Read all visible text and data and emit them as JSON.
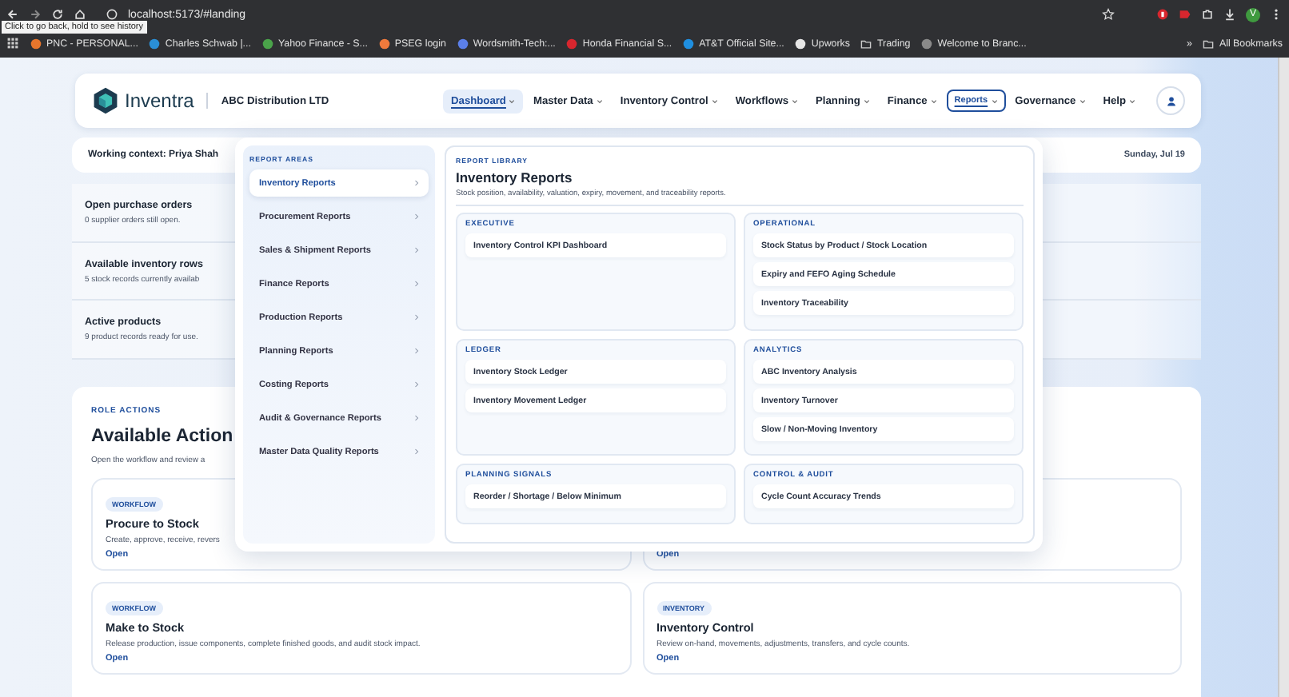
{
  "browser": {
    "url": "localhost:5173/#landing",
    "tooltip": "Click to go back, hold to see history",
    "profile_initial": "V",
    "bookmarks": [
      {
        "label": "PNC - PERSONAL...",
        "kind": "site",
        "color": "#e8762c"
      },
      {
        "label": "Charles Schwab |...",
        "kind": "site",
        "color": "#2a8fd6"
      },
      {
        "label": "Yahoo Finance - S...",
        "kind": "site",
        "color": "#4aa34a"
      },
      {
        "label": "PSEG login",
        "kind": "site",
        "color": "#f07a3c"
      },
      {
        "label": "Wordsmith-Tech:...",
        "kind": "site",
        "color": "#5b7fe8"
      },
      {
        "label": "Honda Financial S...",
        "kind": "site",
        "color": "#d8262e"
      },
      {
        "label": "AT&T Official Site...",
        "kind": "site",
        "color": "#1f8fe0"
      },
      {
        "label": "Upworks",
        "kind": "site",
        "color": "#e6e6e6"
      },
      {
        "label": "Trading",
        "kind": "folder"
      },
      {
        "label": "Welcome to Branc...",
        "kind": "site",
        "color": "#8a8a8a"
      }
    ],
    "overflow": "»",
    "all_bookmarks": "All Bookmarks"
  },
  "header": {
    "brand": "Inventra",
    "company": "ABC Distribution LTD",
    "nav": [
      {
        "label": "Dashboard",
        "selected": true,
        "open": false
      },
      {
        "label": "Master Data",
        "selected": false,
        "open": false
      },
      {
        "label": "Inventory Control",
        "selected": false,
        "open": false
      },
      {
        "label": "Workflows",
        "selected": false,
        "open": false
      },
      {
        "label": "Planning",
        "selected": false,
        "open": false
      },
      {
        "label": "Finance",
        "selected": false,
        "open": false
      },
      {
        "label": "Reports",
        "selected": false,
        "open": true
      },
      {
        "label": "Governance",
        "selected": false,
        "open": false
      },
      {
        "label": "Help",
        "selected": false,
        "open": false
      }
    ]
  },
  "context": {
    "text": "Working context: Priya Shah",
    "date": "Sunday, Jul 19"
  },
  "stats": [
    {
      "title": "Open purchase orders",
      "detail": "0 supplier orders still open."
    },
    {
      "title": "Available inventory rows",
      "detail": "5 stock records currently availab"
    },
    {
      "title": "Active products",
      "detail": "9 product records ready for use."
    }
  ],
  "role_actions": {
    "eyebrow": "ROLE ACTIONS",
    "title": "Available Action",
    "subtitle": "Open the workflow and review a",
    "cards": [
      {
        "badge": "WORKFLOW",
        "title": "Procure to Stock",
        "description": "Create, approve, receive, revers",
        "link": "Open"
      },
      {
        "link": "Open"
      },
      {
        "badge": "WORKFLOW",
        "title": "Make to Stock",
        "description": "Release production, issue components, complete finished goods, and audit stock impact.",
        "link": "Open"
      },
      {
        "badge": "INVENTORY",
        "title": "Inventory Control",
        "description": "Review on-hand, movements, adjustments, transfers, and cycle counts.",
        "link": "Open"
      }
    ]
  },
  "reports_menu": {
    "areas_heading": "REPORT AREAS",
    "areas": [
      {
        "label": "Inventory Reports",
        "selected": true
      },
      {
        "label": "Procurement Reports",
        "selected": false
      },
      {
        "label": "Sales & Shipment Reports",
        "selected": false
      },
      {
        "label": "Finance Reports",
        "selected": false
      },
      {
        "label": "Production Reports",
        "selected": false
      },
      {
        "label": "Planning Reports",
        "selected": false
      },
      {
        "label": "Costing Reports",
        "selected": false
      },
      {
        "label": "Audit & Governance Reports",
        "selected": false
      },
      {
        "label": "Master Data Quality Reports",
        "selected": false
      }
    ],
    "library": {
      "eyebrow": "REPORT LIBRARY",
      "title": "Inventory Reports",
      "subtitle": "Stock position, availability, valuation, expiry, movement, and traceability reports.",
      "groups": [
        {
          "title": "EXECUTIVE",
          "reports": [
            "Inventory Control KPI Dashboard"
          ]
        },
        {
          "title": "OPERATIONAL",
          "reports": [
            "Stock Status by Product / Stock Location",
            "Expiry and FEFO Aging Schedule",
            "Inventory Traceability"
          ]
        },
        {
          "title": "LEDGER",
          "reports": [
            "Inventory Stock Ledger",
            "Inventory Movement Ledger"
          ]
        },
        {
          "title": "ANALYTICS",
          "reports": [
            "ABC Inventory Analysis",
            "Inventory Turnover",
            "Slow / Non-Moving Inventory"
          ]
        },
        {
          "title": "PLANNING SIGNALS",
          "reports": [
            "Reorder / Shortage / Below Minimum"
          ]
        },
        {
          "title": "CONTROL & AUDIT",
          "reports": [
            "Cycle Count Accuracy Trends"
          ]
        }
      ]
    }
  }
}
